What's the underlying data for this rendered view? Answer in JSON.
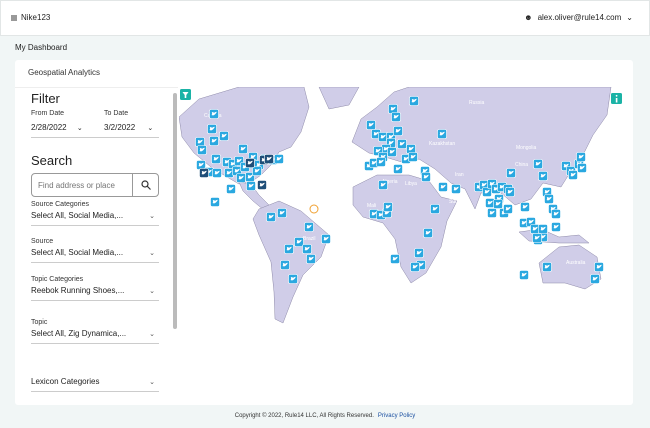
{
  "header": {
    "brand": "Nike123",
    "user_email": "alex.oliver@rule14.com"
  },
  "breadcrumb": "My Dashboard",
  "card": {
    "title": "Geospatial Analytics"
  },
  "filter": {
    "title": "Filter",
    "from_label": "From Date",
    "from_value": "2/28/2022",
    "to_label": "To Date",
    "to_value": "3/2/2022"
  },
  "search": {
    "title": "Search",
    "placeholder": "Find address or place"
  },
  "selects": [
    {
      "label": "Source Categories",
      "value": "Select All, Social Media,..."
    },
    {
      "label": "Source",
      "value": "Select All, Social Media,..."
    },
    {
      "label": "Topic Categories",
      "value": "Reebok Running Shoes,..."
    },
    {
      "label": "Topic",
      "value": "Select All, Zig Dynamica,..."
    },
    {
      "label": "",
      "value": "Lexicon Categories"
    }
  ],
  "map": {
    "land_color": "#d0cde8",
    "marker_color": "#2aa8e0",
    "cluster_color": "#1f4e78",
    "accent": "#1bb3a6",
    "marker_icon": "twitter-bird-icon",
    "labels": [
      "Canada",
      "Russia",
      "Kazakhstan",
      "Mongolia",
      "China",
      "Iran",
      "Algeria",
      "Libya",
      "Sudan",
      "Mali",
      "Brazil",
      "Australia"
    ]
  },
  "footer": {
    "copyright": "Copyright © 2022, Rule14 LLC, All Rights Reserved.",
    "privacy": "Privacy Policy"
  }
}
